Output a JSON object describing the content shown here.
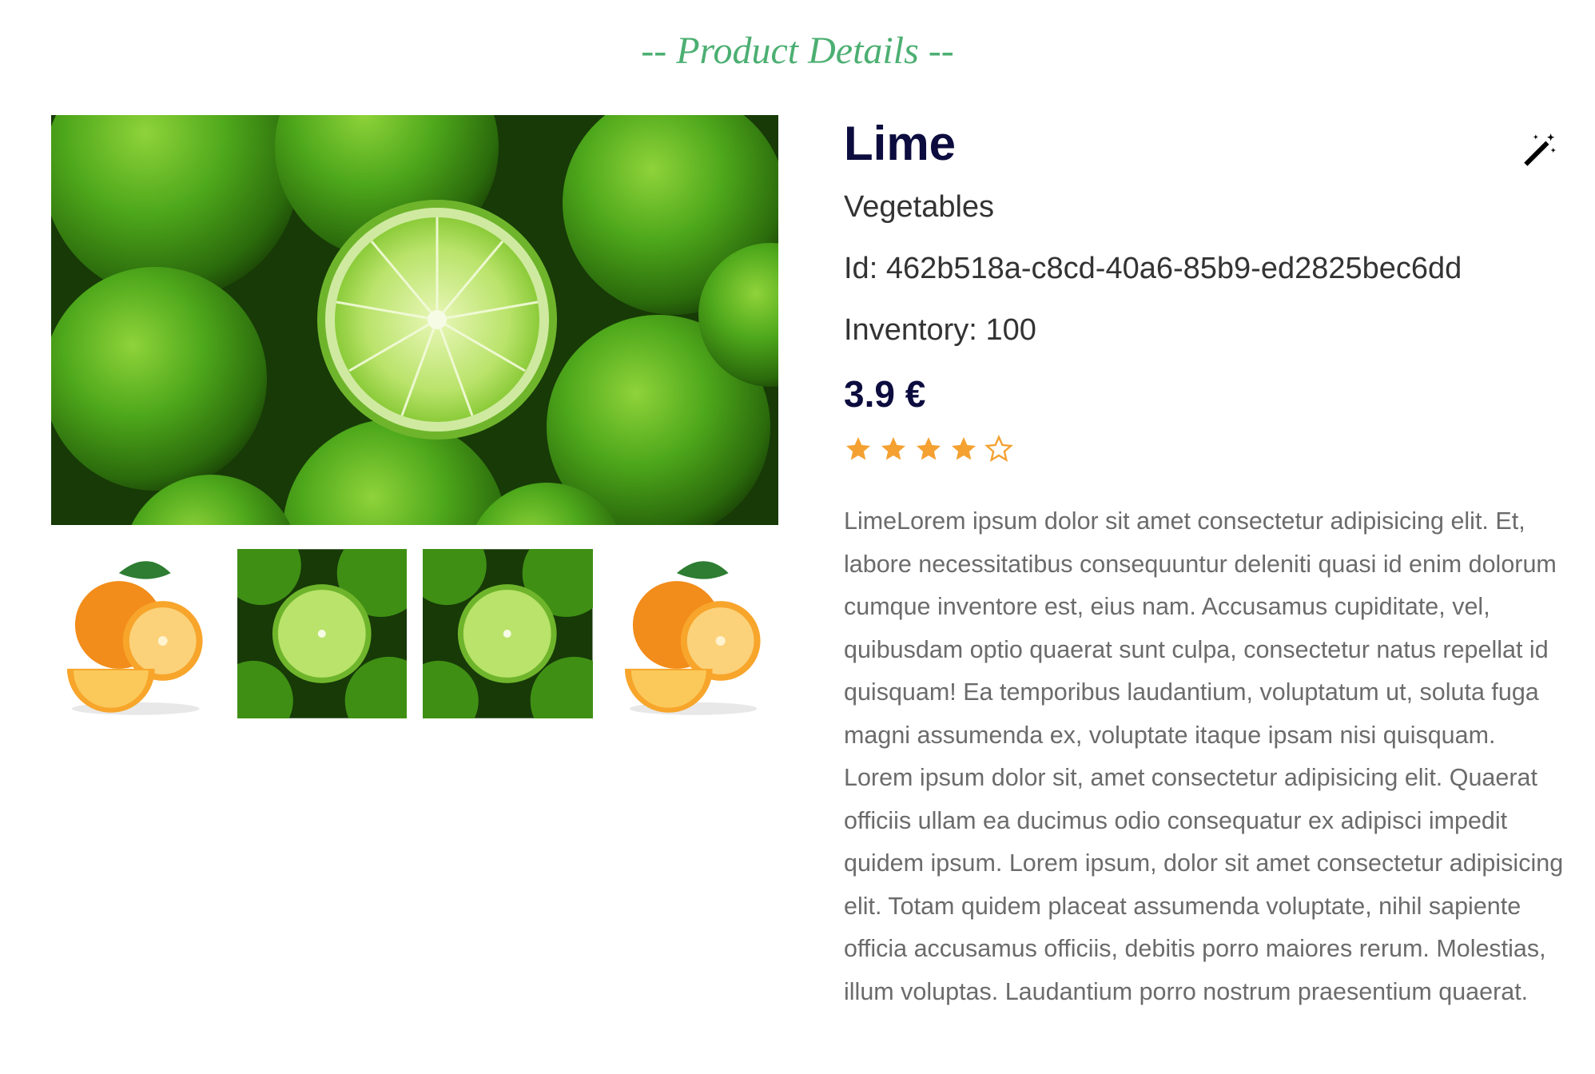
{
  "page": {
    "title": "-- Product Details --"
  },
  "product": {
    "name": "Lime",
    "category": "Vegetables",
    "id_label": "Id:",
    "id_value": "462b518a-c8cd-40a6-85b9-ed2825bec6dd",
    "inventory_label": "Inventory:",
    "inventory_value": "100",
    "price": "3.9 €",
    "rating": 4,
    "rating_max": 5,
    "description": "LimeLorem ipsum dolor sit amet consectetur adipisicing elit. Et, labore necessitatibus consequuntur deleniti quasi id enim dolorum cumque inventore est, eius nam. Accusamus cupiditate, vel, quibusdam optio quaerat sunt culpa, consectetur natus repellat id quisquam! Ea temporibus laudantium, voluptatum ut, soluta fuga magni assumenda ex, voluptate itaque ipsam nisi quisquam. Lorem ipsum dolor sit, amet consectetur adipisicing elit. Quaerat officiis ullam ea ducimus odio consequatur ex adipisci impedit quidem ipsum. Lorem ipsum, dolor sit amet consectetur adipisicing elit. Totam quidem placeat assumenda voluptate, nihil sapiente officia accusamus officiis, debitis porro maiores rerum. Molestias, illum voluptas. Laudantium porro nostrum praesentium quaerat."
  },
  "gallery": {
    "main_image": "limes-image",
    "thumbnails": [
      "oranges-image",
      "limes-image",
      "limes-image",
      "oranges-image"
    ]
  },
  "icons": {
    "edit": "magic-wand-icon",
    "star_filled": "star-filled-icon",
    "star_empty": "star-outline-icon"
  },
  "colors": {
    "title": "#4caf72",
    "heading": "#0c0c3f",
    "star": "#f4a132",
    "text": "#333333",
    "description": "#6b6b6b"
  }
}
